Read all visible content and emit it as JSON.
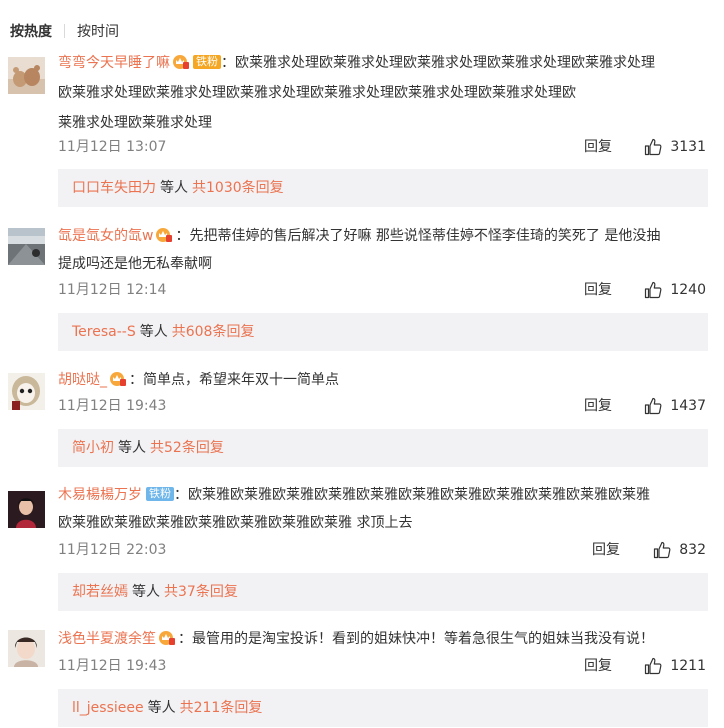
{
  "sort": {
    "hot_label": "按热度",
    "time_label": "按时间"
  },
  "comments": [
    {
      "username": "弯弯今天早睡了嘛",
      "badge": "铁粉",
      "lines": [
        "：欧莱雅求处理欧莱雅求处理欧莱雅求处理欧莱雅求处理欧莱雅求处理",
        "欧莱雅求处理欧莱雅求处理欧莱雅求处理欧莱雅求处理欧莱雅求处理欧莱雅求处理欧",
        "莱雅求处理欧莱雅求处理"
      ],
      "time": "11月12日 13:07",
      "reply_label": "回复",
      "likes": "3131",
      "sub_user": "口口车失田力",
      "sub_mid": "等人",
      "sub_total": "共1030条回复"
    },
    {
      "username": "氙是氙女的氙w",
      "badge": "",
      "lines": [
        "：先把蒂佳婷的售后解决了好嘛 那些说怪蒂佳婷不怪李佳琦的笑死了 是他没抽",
        "提成吗还是他无私奉献啊"
      ],
      "time": "11月12日 12:14",
      "reply_label": "回复",
      "likes": "1240",
      "sub_user": "Teresa--S",
      "sub_mid": "等人",
      "sub_total": "共608条回复"
    },
    {
      "username": "胡哒哒_",
      "badge": "",
      "lines": [
        "：简单点，希望来年双十一简单点"
      ],
      "time": "11月12日 19:43",
      "reply_label": "回复",
      "likes": "1437",
      "sub_user": "简小初",
      "sub_mid": "等人",
      "sub_total": "共52条回复"
    },
    {
      "username": "木易楊楊万岁",
      "badge": "铁粉",
      "lines": [
        "：欧莱雅欧莱雅欧莱雅欧莱雅欧莱雅欧莱雅欧莱雅欧莱雅欧莱雅欧莱雅欧莱雅",
        "欧莱雅欧莱雅欧莱雅欧莱雅欧莱雅欧莱雅欧莱雅 求顶上去"
      ],
      "time": "11月12日 22:03",
      "reply_label": "回复",
      "likes": "832",
      "sub_user": "却若丝嫣",
      "sub_mid": "等人",
      "sub_total": "共37条回复"
    },
    {
      "username": "浅色半夏渡余笙",
      "badge": "",
      "lines": [
        "：最管用的是淘宝投诉！看到的姐妹快冲！等着急很生气的姐妹当我没有说！"
      ],
      "time": "11月12日 19:43",
      "reply_label": "回复",
      "likes": "1211",
      "sub_user": "ll_jessieee",
      "sub_mid": "等人",
      "sub_total": "共211条回复"
    }
  ],
  "icons": {
    "like": "thumbs-up-icon",
    "vip": "vip-crown-icon"
  },
  "colors": {
    "username": "#eb7350",
    "subbox_bg": "#f2f2f5",
    "fan_gold": "#f5a623",
    "fan_blue": "#6fb6ea"
  }
}
